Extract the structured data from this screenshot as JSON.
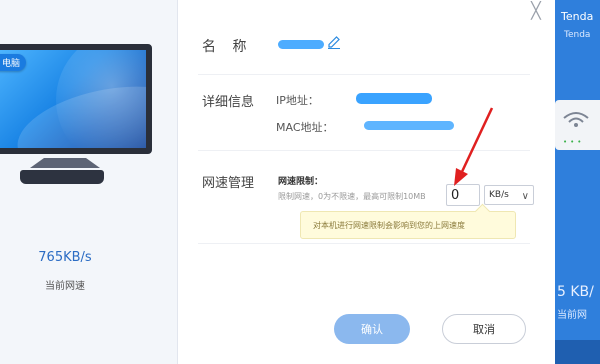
{
  "left": {
    "device_badge": "电脑",
    "speed_value": "765KB/s",
    "speed_label": "当前网速"
  },
  "dialog": {
    "name_label": "名  称",
    "name_value": "",
    "detail_label": "详细信息",
    "ip_key": "IP地址：",
    "ip_value": "",
    "mac_key": "MAC地址：",
    "mac_value": "",
    "speed_mgmt_label": "网速管理",
    "limit_title": "网速限制：",
    "limit_hint": "限制网速，0为不限速，最高可限制10MB",
    "limit_value": "0",
    "unit_options": [
      "KB/s"
    ],
    "unit_selected": "KB/s",
    "tooltip": "对本机进行网速限制会影响到您的上网速度",
    "confirm_label": "确认",
    "cancel_label": "取消",
    "close_symbol": "╳"
  },
  "right": {
    "brand": "Tenda",
    "brand_sub": "Tenda",
    "router_lights": "•••",
    "speed_value": "5 KB/",
    "speed_label": "当前网"
  },
  "colors": {
    "accent": "#2b8ae0",
    "confirm_bg": "#8bb8ee",
    "arrow": "#e02020",
    "tooltip_bg": "#fffbdc",
    "router_panel": "#2f7fdc"
  },
  "icons": [
    "edit-icon",
    "close-icon",
    "arrow-annotation-icon",
    "wifi-icon",
    "monitor-icon",
    "chevron-down-icon"
  ]
}
